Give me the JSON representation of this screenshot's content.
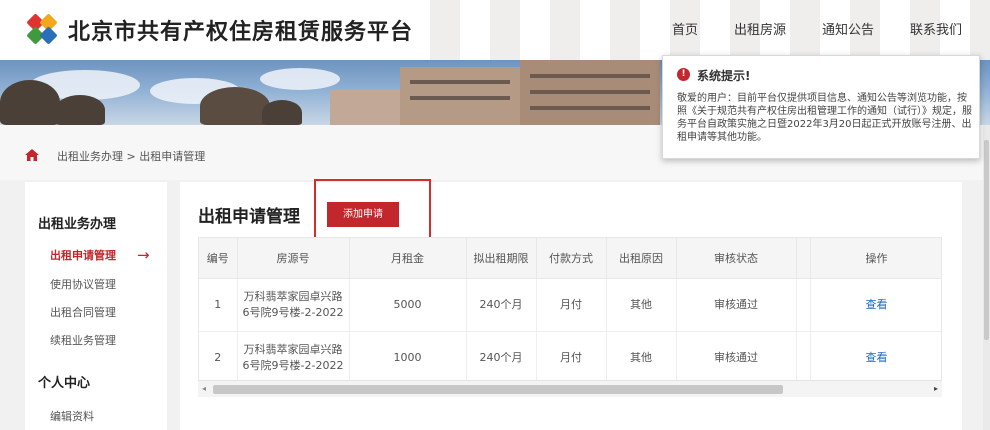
{
  "header": {
    "site_title": "北京市共有产权住房租赁服务平台",
    "nav": [
      "首页",
      "出租房源",
      "通知公告",
      "联系我们"
    ]
  },
  "breadcrumb": {
    "path": "出租业务办理 > 出租申请管理"
  },
  "sidebar": {
    "section1": "出租业务办理",
    "items": [
      "出租申请管理",
      "使用协议管理",
      "出租合同管理",
      "续租业务管理"
    ],
    "section2": "个人中心",
    "personal_items": [
      "编辑资料"
    ],
    "active_arrow": "→"
  },
  "main": {
    "title": "出租申请管理",
    "add_button": "添加申请",
    "columns": [
      "编号",
      "房源号",
      "月租金",
      "拟出租期限",
      "付款方式",
      "出租原因",
      "审核状态",
      "",
      "操作"
    ],
    "rows": [
      {
        "no": "1",
        "house": "万科翡萃家园卓兴路6号院9号楼-2-2022",
        "rent": "5000",
        "term": "240个月",
        "pay": "月付",
        "reason": "其他",
        "status": "审核通过",
        "action": "查看"
      },
      {
        "no": "2",
        "house": "万科翡萃家园卓兴路6号院9号楼-2-2022",
        "rent": "1000",
        "term": "240个月",
        "pay": "月付",
        "reason": "其他",
        "status": "审核通过",
        "action": "查看"
      }
    ]
  },
  "notice": {
    "title": "系统提示!",
    "body": "敬爱的用户：目前平台仅提供项目信息、通知公告等浏览功能，按照《关于规范共有产权住房出租管理工作的通知（试行）》规定，服务平台自政策实施之日暨2022年3月20日起正式开放账号注册、出租申请等其他功能。"
  },
  "colors": {
    "brand_red": "#c1272d",
    "link_blue": "#1f66c4"
  }
}
